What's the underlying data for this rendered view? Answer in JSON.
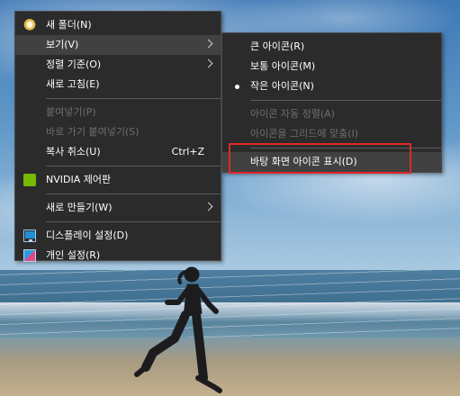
{
  "context_menu": {
    "items": [
      {
        "label": "새 폴더(N)",
        "icon": "folder-icon"
      },
      {
        "label": "보기(V)"
      },
      {
        "label": "정렬 기준(O)"
      },
      {
        "label": "새로 고침(E)"
      },
      {
        "label": "붙여넣기(P)"
      },
      {
        "label": "바로 가기 붙여넣기(S)"
      },
      {
        "label": "복사 취소(U)",
        "shortcut": "Ctrl+Z"
      },
      {
        "label": "NVIDIA 제어판",
        "icon": "nvidia-icon"
      },
      {
        "label": "새로 만들기(W)"
      },
      {
        "label": "디스플레이 설정(D)",
        "icon": "monitor-icon"
      },
      {
        "label": "개인 설정(R)",
        "icon": "personalize-icon"
      }
    ]
  },
  "view_submenu": {
    "items": [
      {
        "label": "큰 아이콘(R)"
      },
      {
        "label": "보통 아이콘(M)"
      },
      {
        "label": "작은 아이콘(N)",
        "checked": true
      },
      {
        "label": "아이콘 자동 정렬(A)"
      },
      {
        "label": "아이콘을 그리드에 맞춤(I)"
      },
      {
        "label": "바탕 화면 아이콘 표시(D)"
      }
    ]
  },
  "colors": {
    "menu_background": "#2b2b2b",
    "menu_highlight": "#414141",
    "disabled_text": "#6f6f6f",
    "annotation_box": "#e0262a"
  }
}
